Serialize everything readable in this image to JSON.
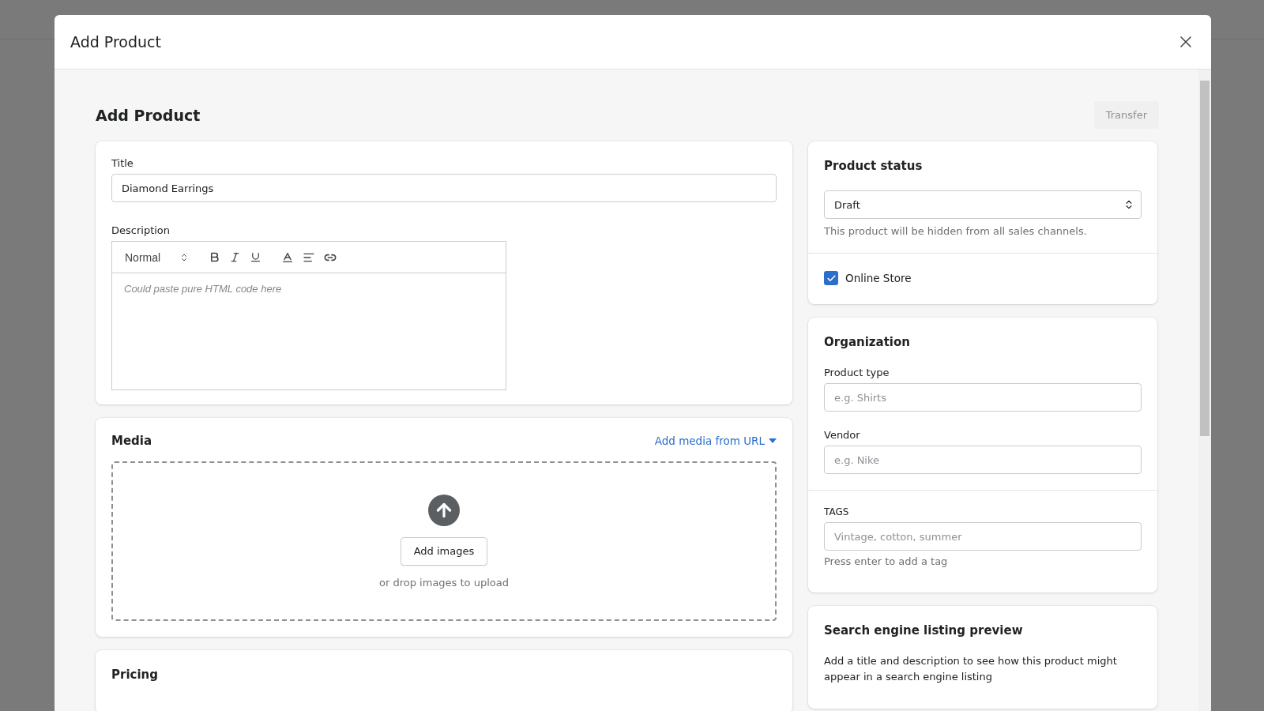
{
  "modal": {
    "title": "Add Product"
  },
  "page": {
    "heading": "Add Product",
    "transfer_button": "Transfer"
  },
  "details_card": {
    "title_label": "Title",
    "title_value": "Diamond Earrings",
    "description_label": "Description",
    "editor": {
      "format": "Normal",
      "placeholder": "Could paste pure HTML code here"
    }
  },
  "media_card": {
    "heading": "Media",
    "url_link": "Add media from URL",
    "upload_button": "Add images",
    "drop_hint": "or drop images to upload"
  },
  "pricing_card": {
    "heading": "Pricing"
  },
  "status_card": {
    "heading": "Product status",
    "status_value": "Draft",
    "status_hint": "This product will be hidden from all sales channels.",
    "channels": [
      {
        "label": "Online Store",
        "checked": true
      }
    ]
  },
  "organization_card": {
    "heading": "Organization",
    "fields": [
      {
        "label": "Product type",
        "placeholder": "e.g. Shirts"
      },
      {
        "label": "Vendor",
        "placeholder": "e.g. Nike"
      }
    ],
    "tags": {
      "label": "TAGS",
      "placeholder": "Vintage, cotton, summer",
      "hint": "Press enter to add a tag"
    }
  },
  "seo_card": {
    "heading": "Search engine listing preview",
    "text": "Add a title and description to see how this product might appear in a search engine listing"
  }
}
